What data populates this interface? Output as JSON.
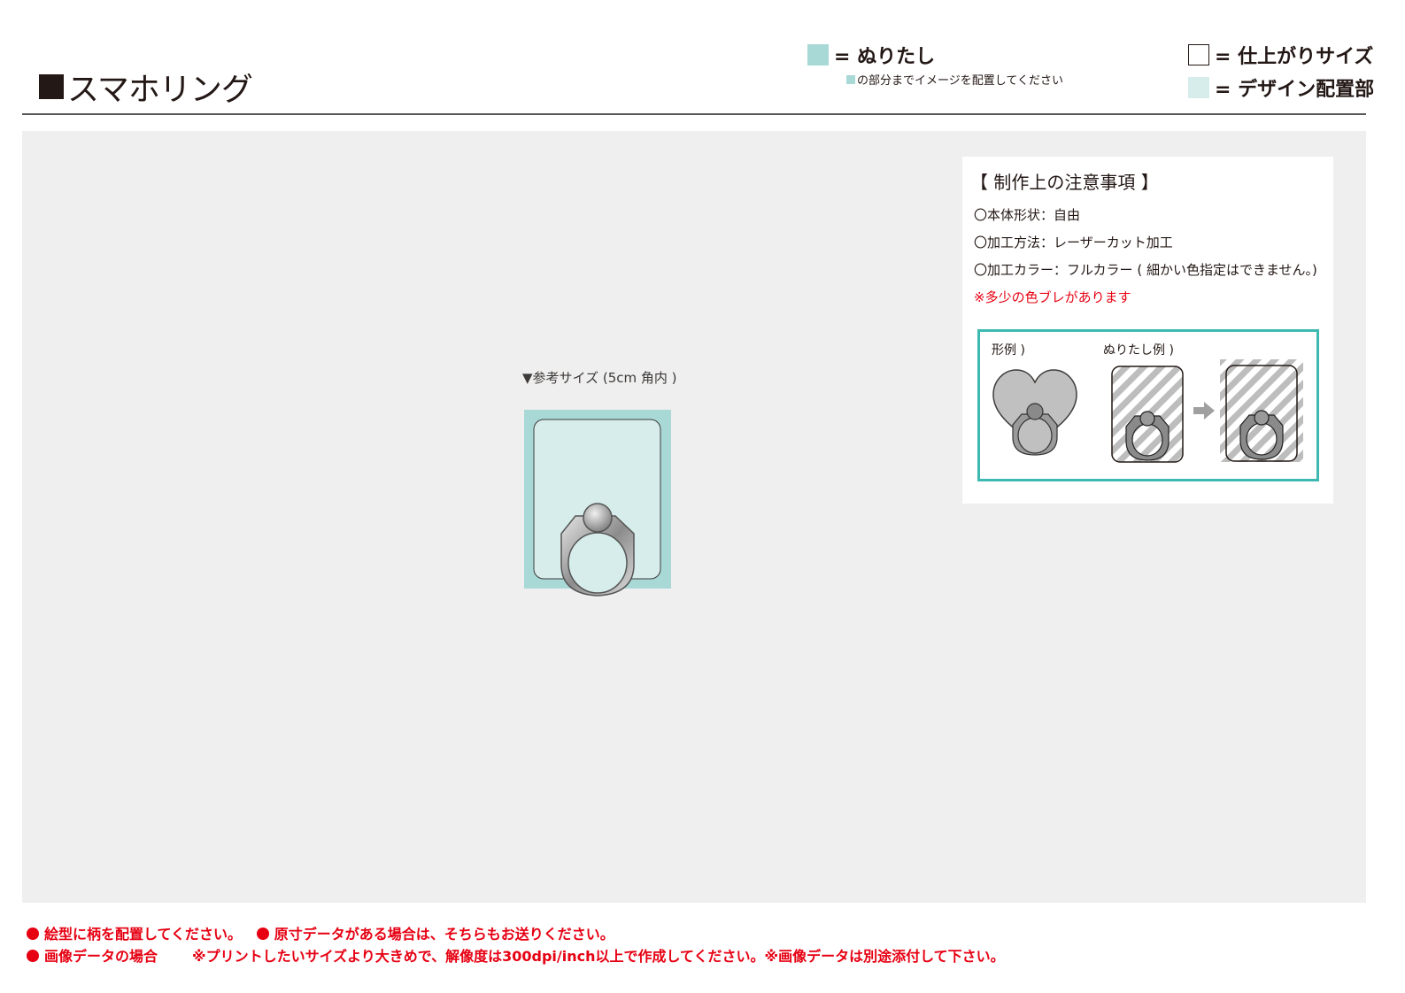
{
  "header": {
    "title": "スマホリング",
    "legend": {
      "bleed_label": "= ぬりたし",
      "bleed_note": "の部分までイメージを配置してください",
      "finish_label": "= 仕上がりサイズ",
      "design_label": "= デザイン配置部"
    }
  },
  "colors": {
    "bleed": "#a8d9d6",
    "design_area": "#d6edeb",
    "canvas": "#eeefee",
    "accent_border": "#3db9b2",
    "warning": "#e60012"
  },
  "main": {
    "reference_label": "▼参考サイズ (5cm 角内 )"
  },
  "notes": {
    "title": "【 制作上の注意事項 】",
    "items": [
      "〇本体形状：自由",
      "〇加工方法：レーザーカット加工",
      "〇加工カラー：フルカラー ( 細かい色指定はできません。)"
    ],
    "warning": "※多少の色ブレがあります",
    "examples": {
      "shape_label": "形例 )",
      "bleed_label": "ぬりたし例 )"
    }
  },
  "footer": {
    "line1_a": "絵型に柄を配置してください。",
    "line1_b": "原寸データがある場合は、そちらもお送りください。",
    "line2_a": "画像データの場合",
    "line2_b": "※プリントしたいサイズより大きめで、解像度は300dpi/inch以上で作成してください。※画像データは別途添付して下さい。"
  }
}
